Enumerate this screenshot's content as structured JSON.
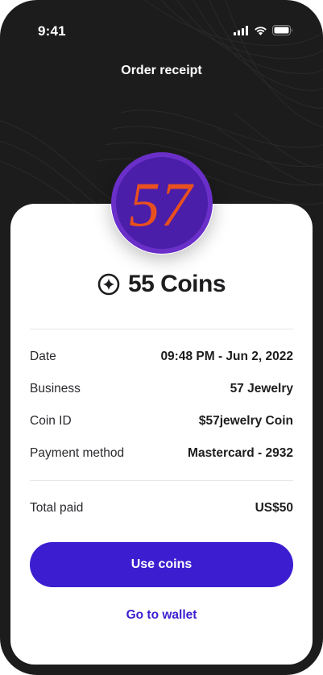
{
  "status_bar": {
    "time": "9:41",
    "icons": [
      "cellular-signal-icon",
      "wifi-icon",
      "battery-icon"
    ]
  },
  "header": {
    "title": "Order receipt"
  },
  "business_logo": {
    "text": "57",
    "colors": {
      "ring": "#6a2fc9",
      "fill": "#4a1ea8",
      "numeral": "#e8501f"
    }
  },
  "coins": {
    "icon": "coin-star-icon",
    "amount_label": "55 Coins"
  },
  "details": [
    {
      "label": "Date",
      "value": "09:48 PM - Jun 2, 2022"
    },
    {
      "label": "Business",
      "value": "57 Jewelry"
    },
    {
      "label": "Coin ID",
      "value": "$57jewelry Coin"
    },
    {
      "label": "Payment method",
      "value": "Mastercard - 2932"
    }
  ],
  "total": {
    "label": "Total paid",
    "value": "US$50"
  },
  "actions": {
    "primary_label": "Use coins",
    "secondary_label": "Go to wallet"
  },
  "colors": {
    "accent": "#3c1ed0",
    "background_dark": "#1c1c1c",
    "card": "#ffffff"
  }
}
